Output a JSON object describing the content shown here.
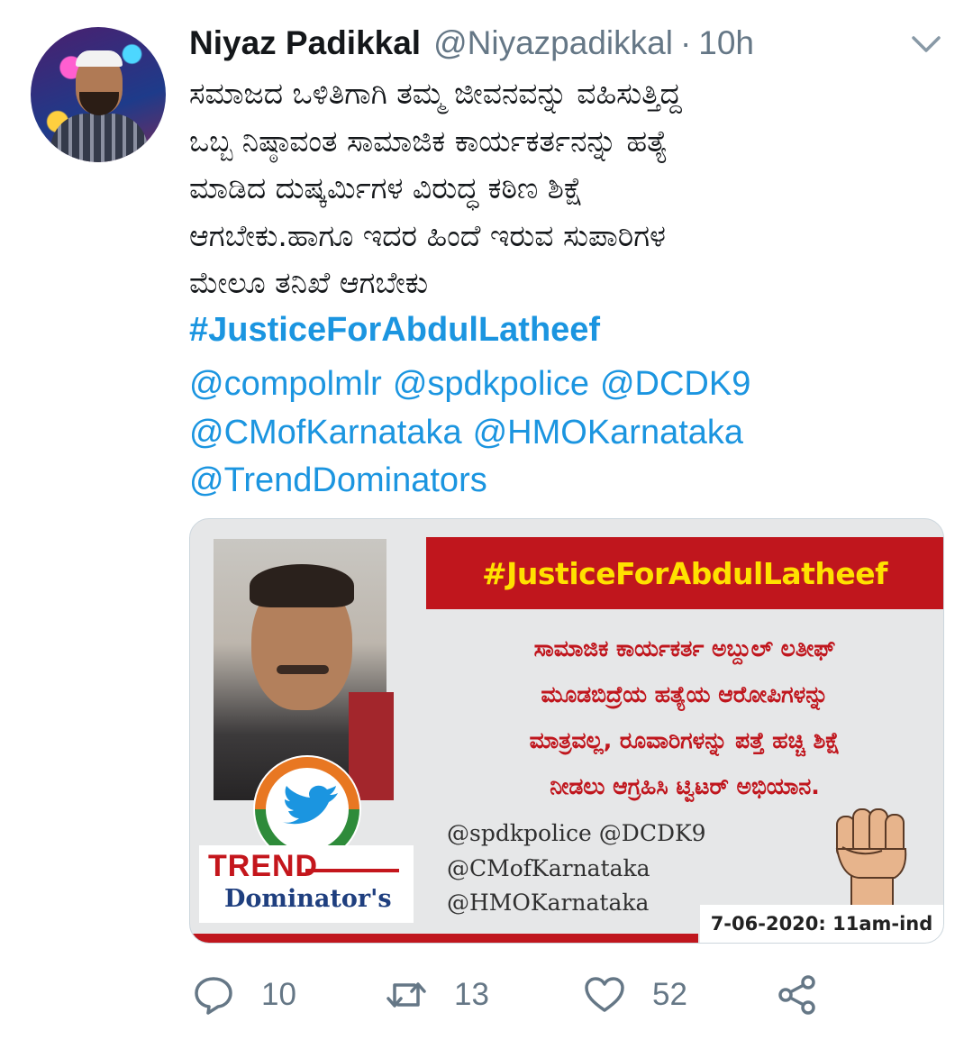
{
  "author": {
    "name": "Niyaz Padikkal",
    "handle": "@Niyazpadikkal",
    "separator": "·",
    "time": "10h"
  },
  "tweet": {
    "lines": [
      "ಸಮಾಜದ ಒಳಿತಿಗಾಗಿ ತಮ್ಮ ಜೀವನವನ್ನು ವಹಿಸುತ್ತಿದ್ದ",
      "ಒಬ್ಬ ನಿಷ್ಠಾವಂತ ಸಾಮಾಜಿಕ ಕಾರ್ಯಕರ್ತನನ್ನು ಹತ್ಯೆ",
      "ಮಾಡಿದ ದುಷ್ಕರ್ಮಿಗಳ ವಿರುದ್ಧ ಕಠಿಣ ಶಿಕ್ಷೆ",
      "ಆಗಬೇಕು.ಹಾಗೂ ಇದರ ಹಿಂದೆ ಇರುವ ಸುಪಾರಿಗಳ",
      "ಮೇಲೂ ತನಿಖೆ ಆಗಬೇಕು"
    ],
    "hashtag": "#JusticeForAbdulLatheef",
    "mentions": [
      "@compolmlr",
      "@spdkpolice",
      "@DCDK9",
      "@CMofKarnataka",
      "@HMOKarnataka",
      "@TrendDominators"
    ]
  },
  "media": {
    "banner": "#JusticeForAbdulLatheef",
    "body_lines": [
      "ಸಾಮಾಜಿಕ ಕಾರ್ಯಕರ್ತ ಅಬ್ದುಲ್ ಲತೀಫ್",
      "ಮೂಡಬಿದ್ರೆಯ ಹತ್ಯೆಯ ಆರೋಪಿಗಳನ್ನು",
      "ಮಾತ್ರವಲ್ಲ, ರೂವಾರಿಗಳನ್ನು ಪತ್ತೆ ಹಚ್ಚಿ ಶಿಕ್ಷೆ",
      "ನೀಡಲು ಆಗ್ರಹಿಸಿ ಟ್ವಿಟರ್ ಅಭಿಯಾನ."
    ],
    "handles": [
      "@spdkpolice @DCDK9",
      "@CMofKarnataka",
      "@HMOKarnataka"
    ],
    "date": "7-06-2020: 11am-ind",
    "logo_word": "TREND",
    "logo_sub": "Dominator's"
  },
  "actions": {
    "replies": "10",
    "retweets": "13",
    "likes": "52"
  },
  "icons": [
    "chevron-down-icon",
    "twitter-bird-icon",
    "fist-icon",
    "reply-icon",
    "retweet-icon",
    "like-icon",
    "share-icon"
  ],
  "colors": {
    "link": "#1b95e0",
    "muted": "#657786",
    "banner_red": "#c0161d",
    "banner_yellow": "#ffe100"
  }
}
